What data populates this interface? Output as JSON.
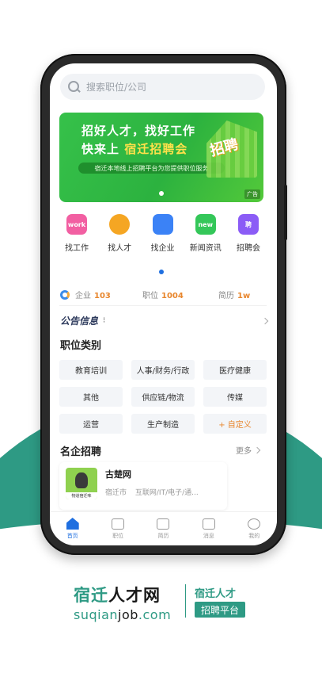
{
  "search": {
    "placeholder": "搜索职位/公司"
  },
  "banner": {
    "title": "招好人才，找好工作",
    "sub_prefix": "快来上",
    "sub_highlight": "宿迁招聘会",
    "pill": "宿迁本地线上招聘平台为您提供职位服务",
    "art_text": "招聘",
    "ad_label": "广告"
  },
  "quick_links": [
    {
      "label": "找工作",
      "icon": "work-icon",
      "color": "#f25fa2",
      "glyph": "work"
    },
    {
      "label": "找人才",
      "icon": "talent-icon",
      "color": "#f5a623",
      "glyph": ""
    },
    {
      "label": "找企业",
      "icon": "company-icon",
      "color": "#3b82f6",
      "glyph": ""
    },
    {
      "label": "新闻资讯",
      "icon": "news-icon",
      "color": "#34c759",
      "glyph": "new"
    },
    {
      "label": "招聘会",
      "icon": "job-fair-icon",
      "color": "#8b5cf6",
      "glyph": "聘"
    }
  ],
  "stats": [
    {
      "label": "企业",
      "value": "103"
    },
    {
      "label": "职位",
      "value": "1004"
    },
    {
      "label": "简历",
      "value": "1w"
    }
  ],
  "notice": {
    "title": "公告信息",
    "more": "⁝"
  },
  "categories_title": "职位类别",
  "categories": [
    "教育培训",
    "人事/财务/行政",
    "医疗健康",
    "其他",
    "供应链/物流",
    "传媒",
    "运营",
    "生产制造",
    "+ 自定义"
  ],
  "companies_title": "名企招聘",
  "companies_more": "更多",
  "company": {
    "name": "古楚网",
    "city": "宿迁市",
    "industry": "互联网/IT/电子/通...",
    "logo_caption": "物道宿迁味"
  },
  "tabs": [
    {
      "label": "首页",
      "active": true
    },
    {
      "label": "职位",
      "active": false
    },
    {
      "label": "简历",
      "active": false
    },
    {
      "label": "消息",
      "active": false
    },
    {
      "label": "我的",
      "active": false
    }
  ],
  "brand": {
    "name_part1": "宿迁",
    "name_part2": "人才网",
    "url_part1": "suqian",
    "url_part2": "job",
    "url_part3": ".com",
    "tag_line1": "宿迁人才",
    "tag_line2": "招聘平台"
  },
  "colors": {
    "brand_teal": "#2e9a84",
    "accent_blue": "#1f6fe0",
    "accent_orange": "#e8862d",
    "banner_green": "#36c14a"
  }
}
